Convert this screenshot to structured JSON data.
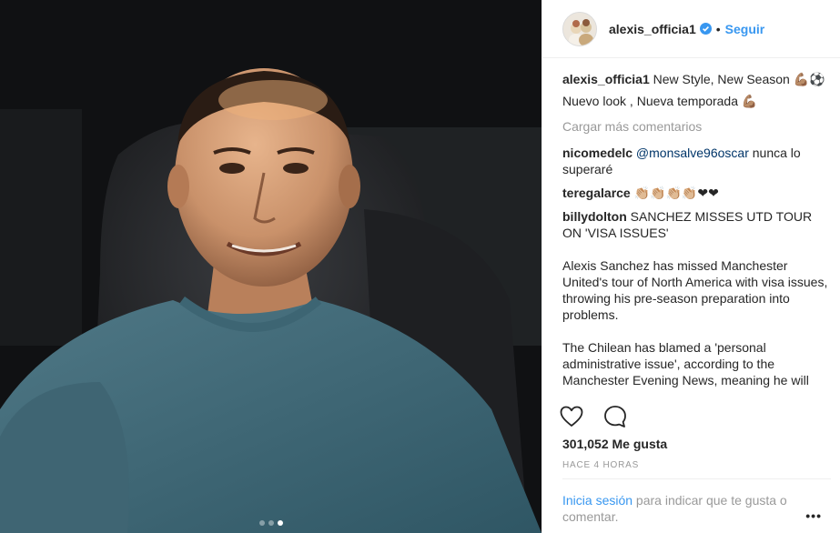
{
  "header": {
    "username": "alexis_officia1",
    "separator": "•",
    "follow_label": "Seguir"
  },
  "caption": {
    "username": "alexis_officia1",
    "line1": "New Style, New Season 💪🏽⚽",
    "line2": "Nuevo look , Nueva temporada 💪🏽"
  },
  "load_more": "Cargar más comentarios",
  "comments": [
    {
      "username": "nicomedelc",
      "mention": "@monsalve96oscar",
      "text": " nunca lo superaré"
    },
    {
      "username": "teregalarce",
      "text": "👏🏼👏🏼👏🏼👏🏼❤❤"
    },
    {
      "username": "billydolton",
      "text": "SANCHEZ MISSES UTD TOUR ON 'VISA ISSUES'"
    }
  ],
  "article": {
    "p1": "Alexis Sanchez has missed Manchester United's tour of North America with visa issues, throwing his pre-season preparation into problems.",
    "p2": "The Chilean has blamed a 'personal administrative issue', according to the Manchester Evening News, meaning he will"
  },
  "likes": "301,052 Me gusta",
  "time": "HACE 4 HORAS",
  "login": {
    "link": "Inicia sesión",
    "rest": " para indicar que te gusta o comentar."
  },
  "more_label": "•••",
  "icons": {
    "heart": "heart-icon",
    "comment": "comment-icon",
    "verified": "verified-badge-icon"
  },
  "colors": {
    "link_blue": "#3897f0",
    "mention_blue": "#003569",
    "muted_gray": "#999999"
  }
}
